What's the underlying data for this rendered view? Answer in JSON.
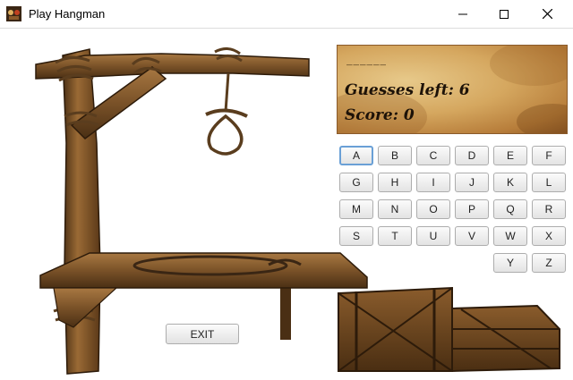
{
  "window": {
    "title": "Play Hangman",
    "controls": {
      "minimize": "minimize-icon",
      "maximize": "maximize-icon",
      "close": "close-icon"
    }
  },
  "game": {
    "word_display": "______",
    "guesses_left": "Guesses left: 6",
    "score": "Score: 0"
  },
  "keyboard": {
    "keys": [
      "A",
      "B",
      "C",
      "D",
      "E",
      "F",
      "G",
      "H",
      "I",
      "J",
      "K",
      "L",
      "M",
      "N",
      "O",
      "P",
      "Q",
      "R",
      "S",
      "T",
      "U",
      "V",
      "W",
      "X",
      "Y",
      "Z"
    ],
    "focused_key": "A"
  },
  "exit_button": {
    "label": "EXIT"
  },
  "colors": {
    "parchment": "#d5a75f",
    "wood": "#7a5228",
    "focus": "#6aa0d6"
  }
}
